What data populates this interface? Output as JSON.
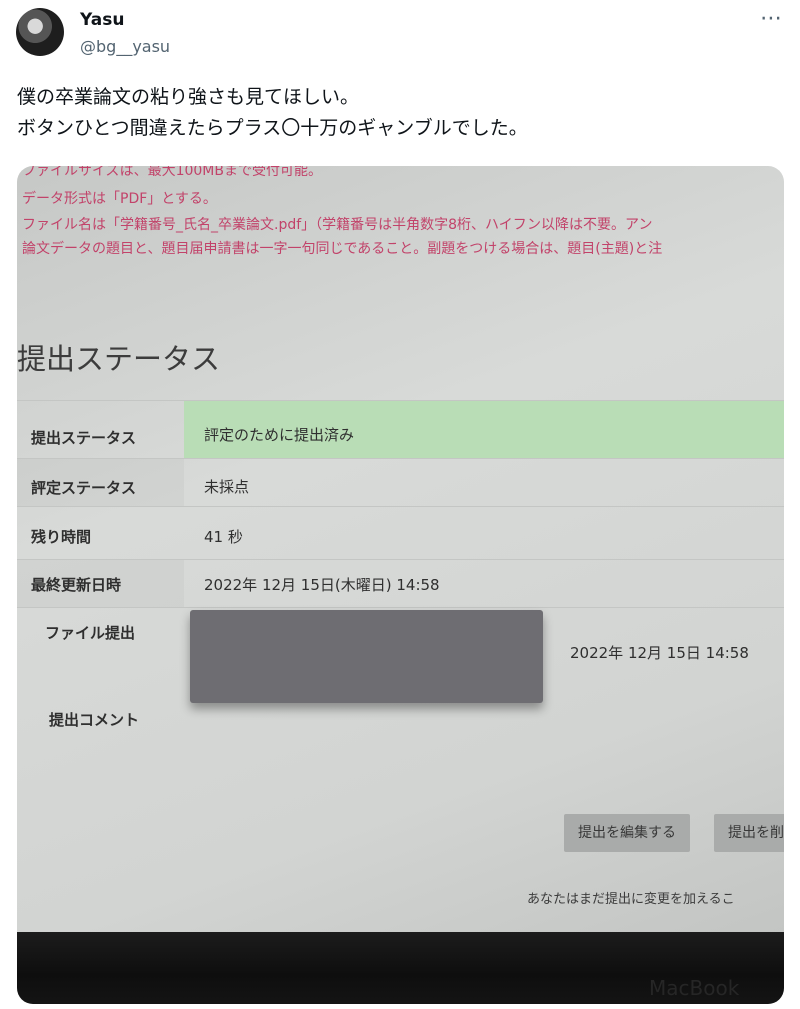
{
  "author": {
    "name": "Yasu",
    "handle": "@bg__yasu"
  },
  "more_icon": "⋯",
  "tweet_text": "僕の卒業論文の粘り強さも見てほしい。\nボタンひとつ間違えたらプラス〇十万のギャンブルでした。",
  "photo": {
    "notes": [
      "ファイルサイズは、最大100MBまで受付可能。",
      "データ形式は「PDF」とする。",
      "ファイル名は「学籍番号_氏名_卒業論文.pdf」（学籍番号は半角数字8桁、ハイフン以降は不要。アン",
      "論文データの題目と、題目届申請書は一字一句同じであること。副題をつける場合は、題目(主題)と注"
    ],
    "section_title": "提出ステータス",
    "rows": {
      "submission_status": {
        "label": "提出ステータス",
        "value": "評定のために提出済み"
      },
      "grading_status": {
        "label": "評定ステータス",
        "value": "未採点"
      },
      "time_remaining": {
        "label": "残り時間",
        "value": "41 秒"
      },
      "last_modified": {
        "label": "最終更新日時",
        "value": "2022年 12月 15日(木曜日) 14:58"
      },
      "file_submission": {
        "label": "ファイル提出",
        "value": "2022年 12月 15日 14:58"
      },
      "submission_comments": {
        "label": "提出コメント"
      }
    },
    "buttons": {
      "edit": "提出を編集する",
      "second": "提出を削"
    },
    "footer_note": "あなたはまだ提出に変更を加えるこ",
    "brand": "MacBook"
  }
}
